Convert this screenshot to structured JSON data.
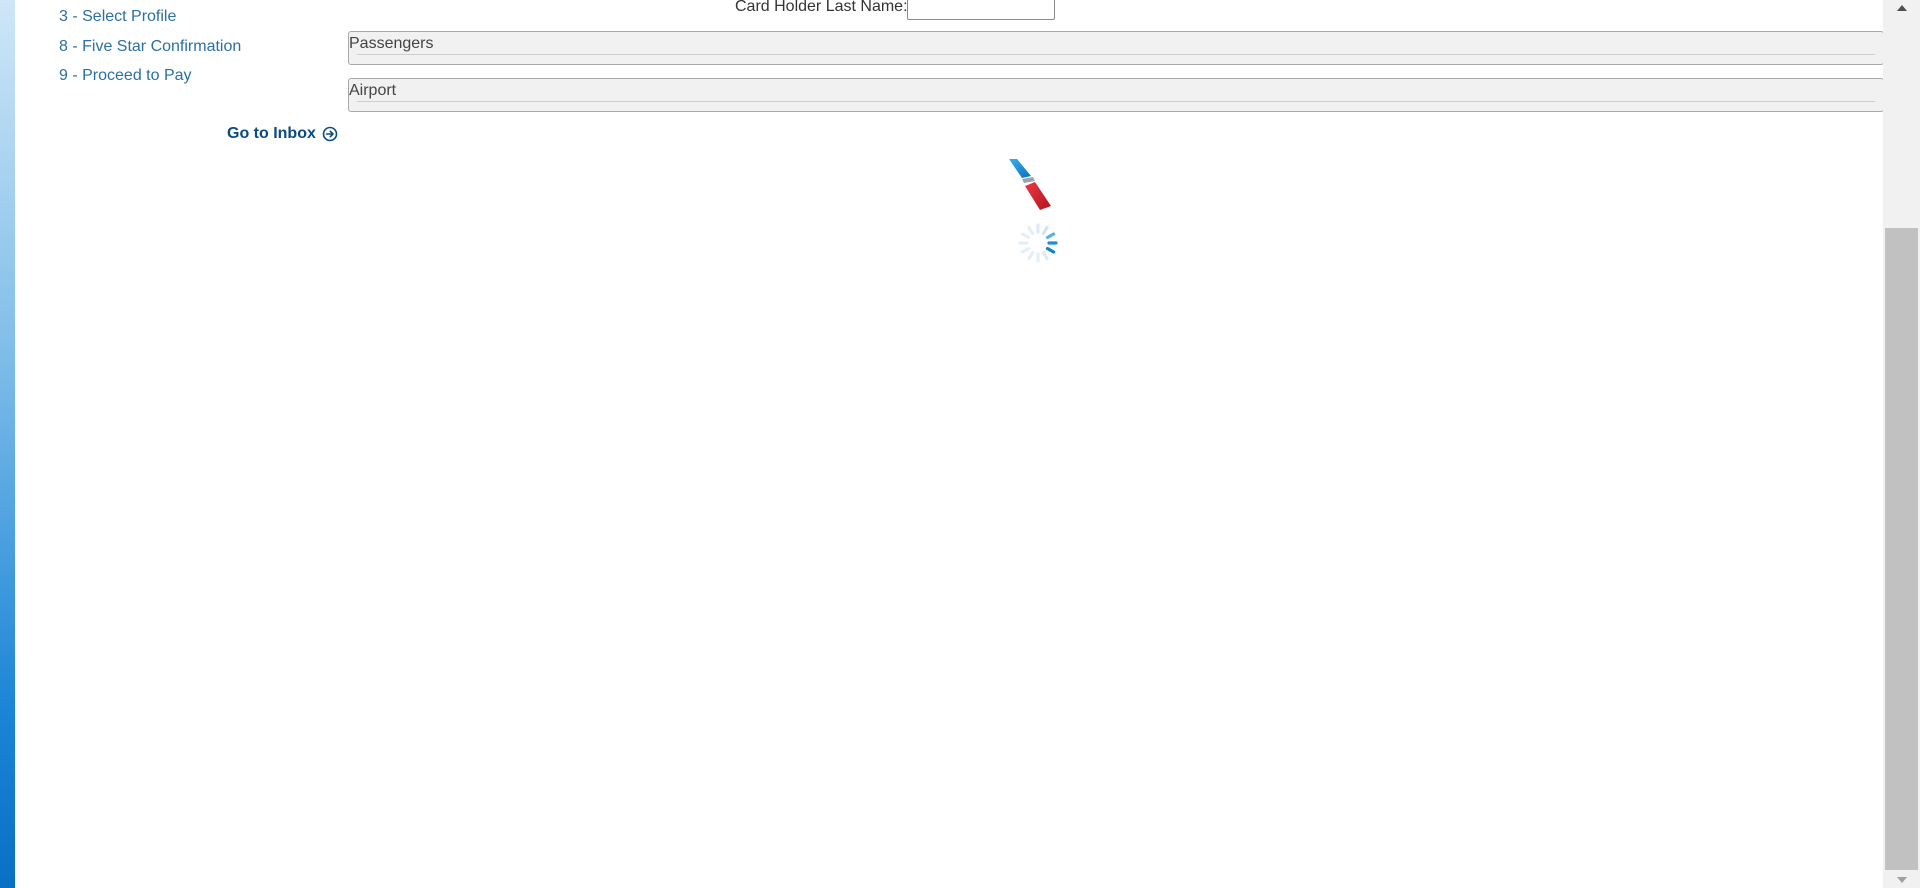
{
  "sidebar": {
    "items": [
      {
        "label": "3 - Select Profile"
      },
      {
        "label": "8 - Five Star Confirmation"
      },
      {
        "label": "9 - Proceed to Pay"
      }
    ],
    "inbox_link": "Go to Inbox"
  },
  "card": {
    "last_name_label": "Card Holder Last Name:",
    "last_name_value": ""
  },
  "sections": {
    "passengers": "Passengers",
    "airport": "Airport"
  },
  "icons": {
    "inbox": "arrow-circle-right-icon",
    "logo": "airline-logo",
    "spinner": "loading-spinner-icon"
  },
  "colors": {
    "link": "#2b6fa3",
    "inbox_link": "#0b4a80",
    "logo_blue": "#1a8fd6",
    "logo_red": "#d0202f"
  }
}
